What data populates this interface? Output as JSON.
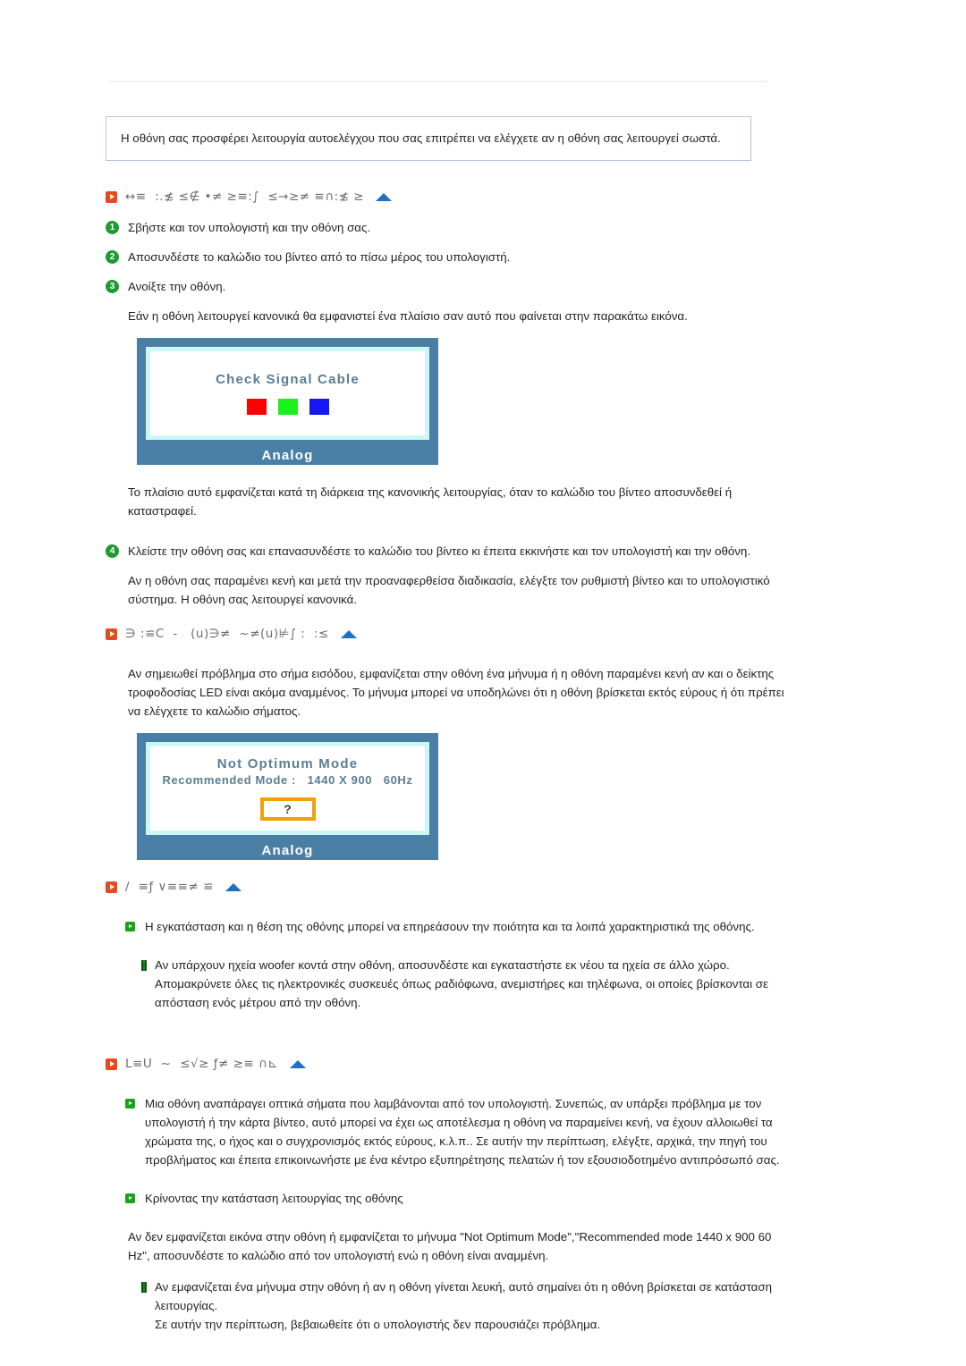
{
  "page": {
    "intro_note": "Η οθόνη σας προσφέρει λειτουργία αυτοελέγχου που σας επιτρέπει να ελέγχετε αν η οθόνη σας λειτουργεί σωστά."
  },
  "headings": {
    "self_test": "↔≡  :.≴ ≤∉ •≠ ≥≡:∫  ≤→≥≠ ≡∩:≴ ≥",
    "warning": "∋ :≌C  -   (u)∋≠  ~≠(u)⊭∫ :  :≤",
    "environment": "/  ≡ƒ ∨≡≡≠ ≌",
    "useful_tips": "L≡U  ~  ≤√≥ ƒ≠ ≳≡ ∩⊾"
  },
  "steps": [
    {
      "num": "1",
      "text": "Σβήστε και τον υπολογιστή και την οθόνη σας."
    },
    {
      "num": "2",
      "text": "Αποσυνδέστε το καλώδιο του βίντεο από το πίσω μέρος του υπολογιστή."
    },
    {
      "num": "3",
      "text": "Ανοίξτε την οθόνη."
    }
  ],
  "step4": {
    "num": "4",
    "text": "Κλείστε την οθόνη σας και επανασυνδέστε το καλώδιο του βίντεο κι έπειτα εκκινήστε και τον υπολογιστή και την οθόνη."
  },
  "paragraphs": {
    "after_step3": "Εάν η οθόνη λειτουργεί κανονικά θα εμφανιστεί ένα πλαίσιο σαν αυτό που φαίνεται στην παρακάτω εικόνα.",
    "after_image1": "Το πλαίσιο αυτό εμφανίζεται κατά τη διάρκεια της κανονικής λειτουργίας, όταν το καλώδιο του βίντεο αποσυνδεθεί ή καταστραφεί.",
    "after_step4": "Αν η οθόνη σας παραμένει κενή και μετά την προαναφερθείσα διαδικασία, ελέγξτε τον ρυθμιστή βίντεο και το υπολογιστικό σύστημα. Η οθόνη σας λειτουργεί κανονικά.",
    "warning_body": "Αν σημειωθεί πρόβλημα στο σήμα εισόδου, εμφανίζεται στην οθόνη ένα μήνυμα ή η οθόνη παραμένει κενή αν και ο δείκτης τροφοδοσίας LED είναι ακόμα αναμμένος. Το μήνυμα μπορεί να υποδηλώνει ότι η οθόνη βρίσκεται εκτός εύρους ή ότι πρέπει να ελέγχετε το καλώδιο σήματος.",
    "power_state_body": "Αν δεν εμφανίζεται εικόνα στην οθόνη ή εμφανίζεται το μήνυμα \"Not Optimum Mode\",\"Recommended mode 1440 x 900 60 Hz\", αποσυνδέστε το καλώδιο από τον υπολογιστή ενώ η οθόνη είναι αναμμένη."
  },
  "monitor1": {
    "osd_title": "Check Signal Cable",
    "label": "Analog",
    "swatches": [
      "#fe0000",
      "#1cf11c",
      "#1616f0"
    ]
  },
  "monitor2": {
    "osd_title": "Not Optimum Mode",
    "osd_line2": "Recommended Mode :   1440 X 900   60Hz",
    "question_mark": "?",
    "label": "Analog"
  },
  "env_section": {
    "bullet1": "Η εγκατάσταση και η θέση της οθόνης μπορεί να επηρεάσουν την ποιότητα και τα λοιπά χαρακτηριστικά της οθόνης.",
    "note1": "Αν υπάρχουν ηχεία woofer κοντά στην οθόνη, αποσυνδέστε και εγκαταστήστε εκ νέου τα ηχεία σε άλλο χώρο.",
    "note2": "Απομακρύνετε όλες τις ηλεκτρονικές συσκευές όπως ραδιόφωνα, ανεμιστήρες και τηλέφωνα, οι οποίες βρίσκονται σε απόσταση ενός μέτρου από την οθόνη."
  },
  "tips_section": {
    "bullet1": "Μια οθόνη αναπάραγει οπτικά σήματα που λαμβάνονται από τον υπολογιστή. Συνεπώς, αν υπάρξει πρόβλημα με τον υπολογιστή ή την κάρτα βίντεο, αυτό μπορεί να έχει ως αποτέλεσμα η οθόνη να παραμείνει κενή, να έχουν αλλοιωθεί τα χρώματα της, ο ήχος και ο συγχρονισμός εκτός εύρους, κ.λ.π.. Σε αυτήν την περίπτωση, ελέγξτε, αρχικά, την πηγή του προβλήματος και έπειτα επικοινωνήστε με ένα κέντρο εξυπηρέτησης πελατών ή τον εξουσιοδοτημένο αντιπρόσωπό σας.",
    "bullet2": "Κρίνοντας την κατάσταση λειτουργίας της οθόνης",
    "note1": "Αν εμφανίζεται ένα μήνυμα στην οθόνη ή αν η οθόνη γίνεται λευκή, αυτό σημαίνει ότι η οθόνη βρίσκεται σε κατάσταση λειτουργίας.",
    "note2": "Σε αυτήν την περίπτωση, βεβαιωθείτε ότι ο υπολογιστής δεν παρουσιάζει πρόβλημα."
  },
  "colors": {
    "note_border": "#b8c4e0",
    "orange_bullet": "#e8491d",
    "green_bullet": "#17a31a",
    "step_circle": "#1d9b33",
    "monitor_bezel": "#4a7fa5",
    "screen_border": "#cdf6f6",
    "osd_text": "#5b7d94",
    "q_border": "#f2a007",
    "blue_triangle": "#1f6fc4"
  }
}
